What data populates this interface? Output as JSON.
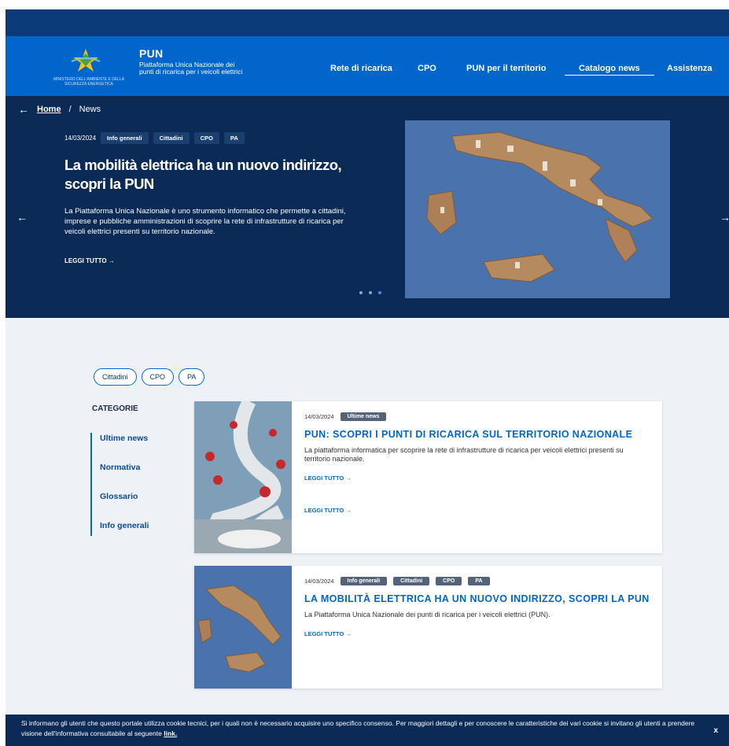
{
  "header": {
    "logo_caption": "MINISTERO DELL'AMBIENTE E DELLA SICUREZZA ENERGETICA",
    "brand_title": "PUN",
    "brand_subtitle": "Piattaforma Unica Nazionale dei punti di ricarica per i veicoli elettrici",
    "nav": [
      {
        "label": "Rete di ricarica",
        "active": false
      },
      {
        "label": "CPO",
        "active": false
      },
      {
        "label": "PUN per il territorio",
        "active": false
      },
      {
        "label": "Catalogo news",
        "active": true
      },
      {
        "label": "Assistenza",
        "active": false
      }
    ],
    "colors": {
      "topbar": "#0a3a78",
      "header": "#0066cc",
      "hero": "#0b2a55"
    }
  },
  "breadcrumb": {
    "back_icon": "arrow-left-icon",
    "home": "Home",
    "separator": "/",
    "current": "News"
  },
  "hero": {
    "date": "14/03/2024",
    "tags": [
      "Info generali",
      "Cittadini",
      "CPO",
      "PA"
    ],
    "title": "La mobilità elettrica ha un nuovo indirizzo, scopri la PUN",
    "text": "La Piattaforma Unica Nazionale è uno strumento informatico che permette a cittadini, imprese e pubbliche amministrazioni di scoprire la rete di infrastrutture di ricarica per veicoli elettrici presenti su territorio nazionale.",
    "read_more": "LEGGI TUTTO →",
    "prev_icon": "←",
    "next_icon": "→",
    "dots": 3,
    "active_dot": 2
  },
  "filters": {
    "chips": [
      "Cittadini",
      "CPO",
      "PA"
    ]
  },
  "categories": {
    "title": "CATEGORIE",
    "items": [
      "Ultime news",
      "Normativa",
      "Glossario",
      "Info generali"
    ]
  },
  "cards": [
    {
      "date": "14/03/2024",
      "tags": [
        "Ultime news"
      ],
      "title": "PUN: SCOPRI I PUNTI DI RICARICA SUL TERRITORIO NAZIONALE",
      "text": "La piattaforma informatica per scoprire la rete di infrastrutture di ricarica per veicoli elettrici presenti su territorio nazionale.",
      "read_more": "LEGGI TUTTO →",
      "read_more_2": "LEGGI TUTTO →"
    },
    {
      "date": "14/03/2024",
      "tags": [
        "Info generali",
        "Cittadini",
        "CPO",
        "PA"
      ],
      "title": "LA MOBILITÀ ELETTRICA HA UN NUOVO INDIRIZZO, SCOPRI LA PUN",
      "text": "La Piattaforma Unica Nazionale dei punti di ricarica per i veicoli elettrici (PUN).",
      "read_more": "LEGGI TUTTO →"
    }
  ],
  "cookie": {
    "text": "Si informano gli utenti che questo portale utilizza cookie tecnici, per i quali non è necessario acquisire uno specifico consenso. Per maggiori dettagli e per conoscere le caratteristiche dei vari cookie si invitano gli utenti a prendere visione dell'informativa consultabile al seguente ",
    "link": "link.",
    "close": "x"
  }
}
